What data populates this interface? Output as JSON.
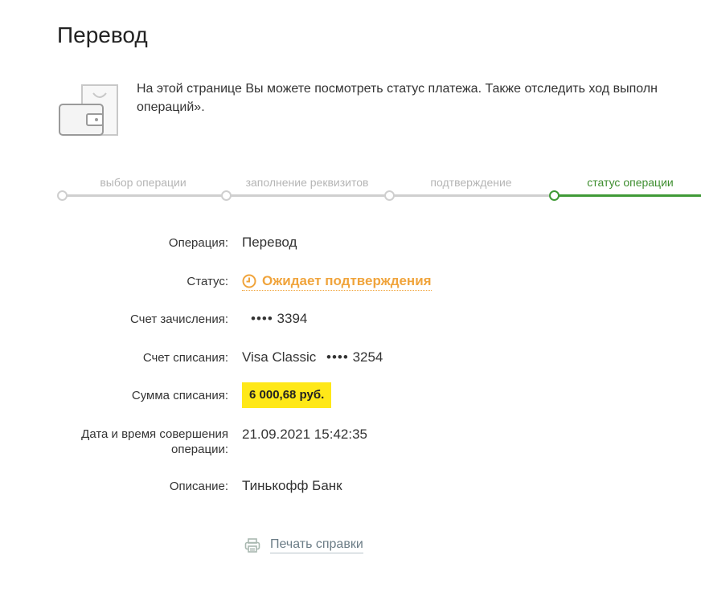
{
  "page": {
    "title": "Перевод"
  },
  "intro": {
    "line1": "На этой странице Вы можете посмотреть статус платежа. Также отследить ход выполн",
    "line2": "операций»."
  },
  "steps": [
    {
      "label": "выбор операции",
      "state": "done"
    },
    {
      "label": "заполнение реквизитов",
      "state": "done"
    },
    {
      "label": "подтверждение",
      "state": "done"
    },
    {
      "label": "статус операции",
      "state": "active"
    }
  ],
  "details": {
    "operation": {
      "label": "Операция:",
      "value": "Перевод"
    },
    "status": {
      "label": "Статус:",
      "value": "Ожидает подтверждения"
    },
    "credit_account": {
      "label": "Счет зачисления:",
      "masked": "••••",
      "last4": "3394"
    },
    "debit_account": {
      "label": "Счет списания:",
      "card_type": "Visa Classic",
      "masked": "••••",
      "last4": "3254"
    },
    "amount": {
      "label": "Сумма списания:",
      "value": "6 000,68 руб."
    },
    "datetime": {
      "label_line1": "Дата и время совершения",
      "label_line2": "операции:",
      "value": "21.09.2021 15:42:35"
    },
    "description": {
      "label": "Описание:",
      "value": "Тинькофф Банк"
    }
  },
  "actions": {
    "print_label": "Печать справки"
  },
  "colors": {
    "accent_green": "#3f9a36",
    "status_orange": "#f0a43c",
    "amount_highlight": "#ffe818",
    "inactive_gray": "#cfcfcf",
    "link_gray": "#6b7c86"
  },
  "icons": {
    "intro": "wallet-icon",
    "status": "clock-icon",
    "print": "printer-icon"
  }
}
